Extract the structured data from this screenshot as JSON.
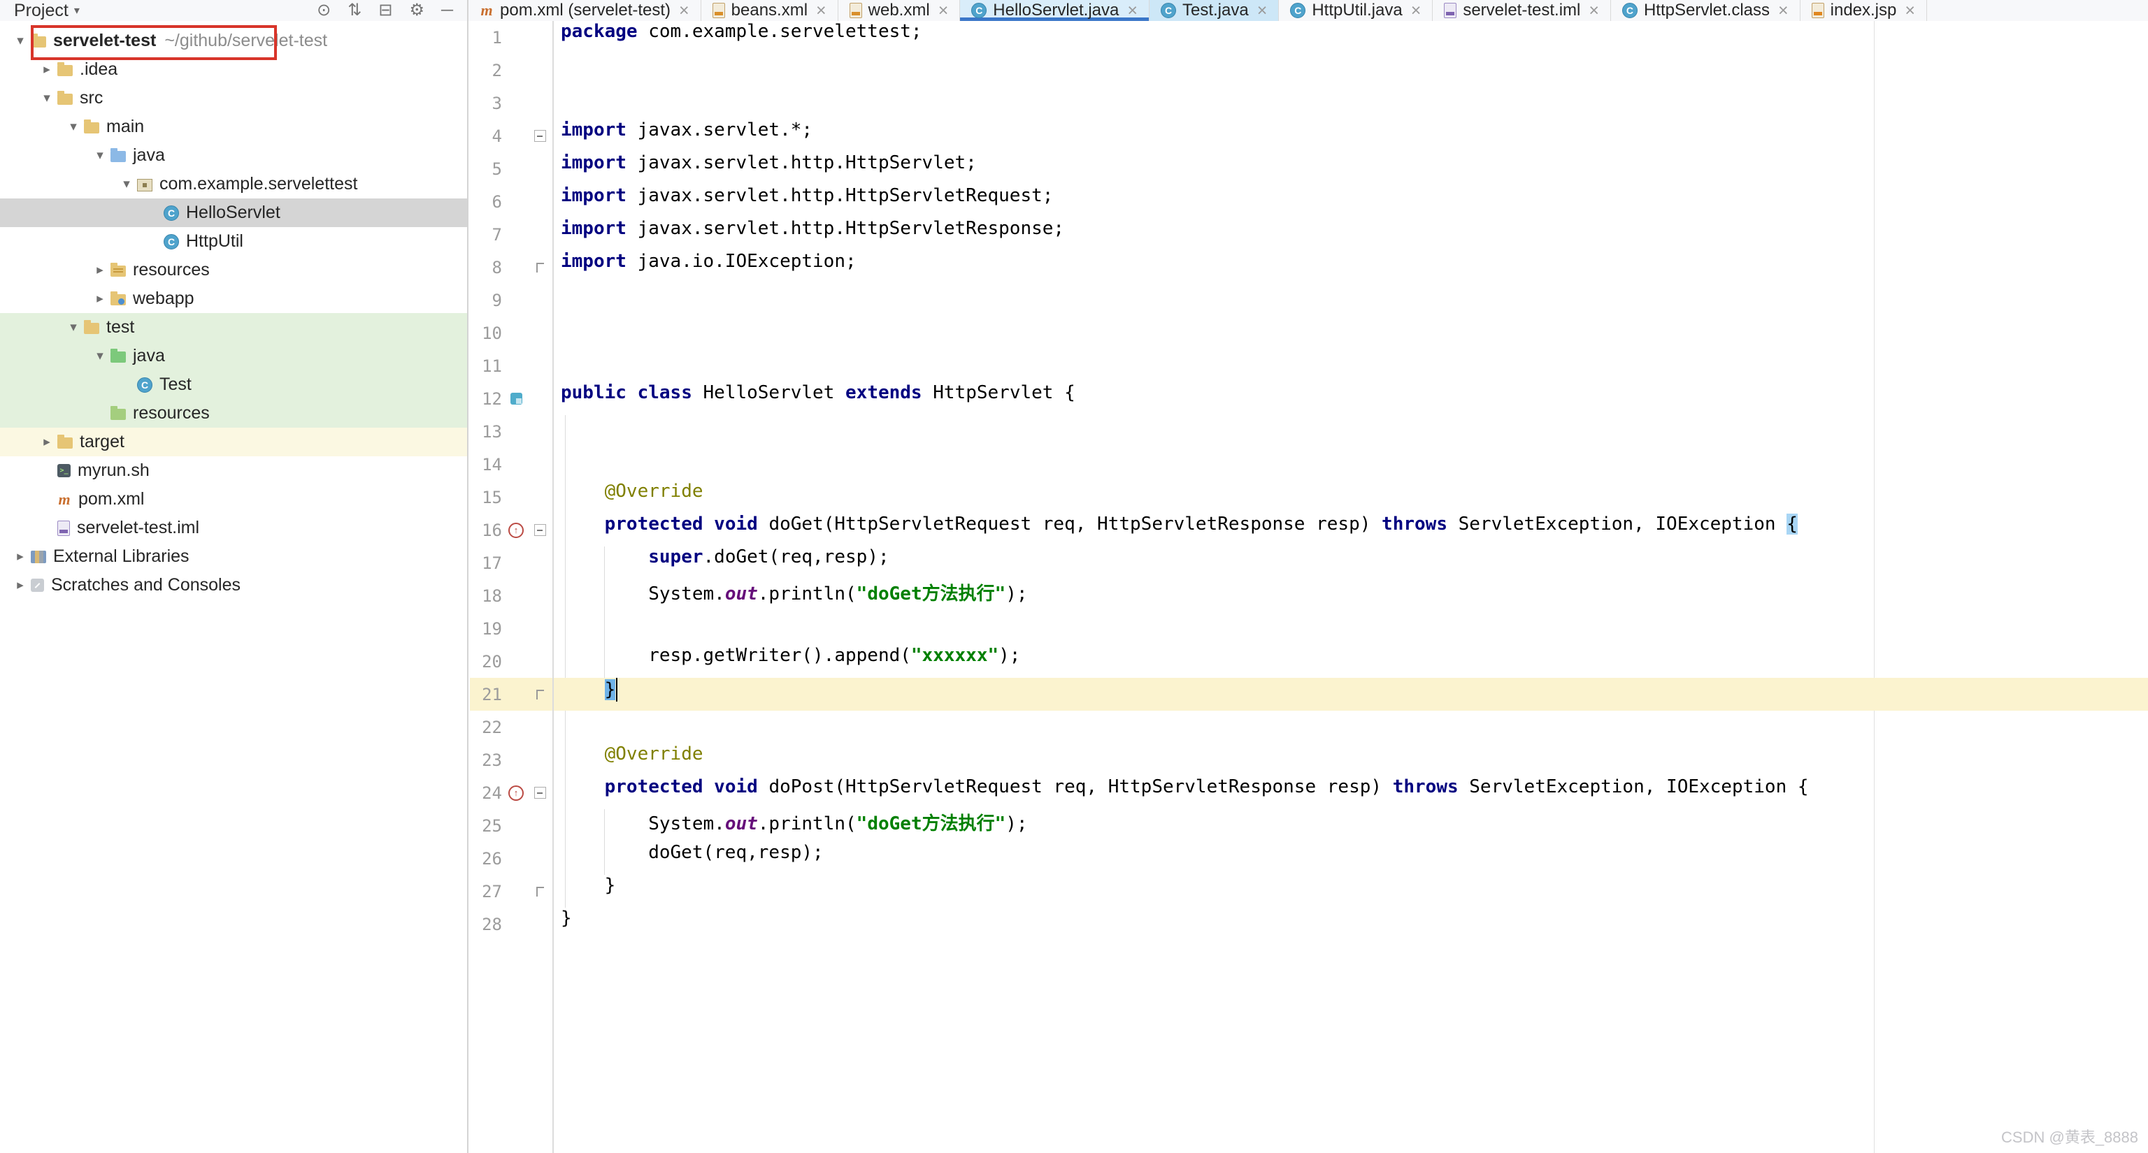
{
  "colors": {
    "keyword": "#000080",
    "string": "#008000",
    "annotation": "#808000",
    "static_field": "#660E7A",
    "active_tab_underline": "#3B77C9",
    "caret_row": "#FBF3CF",
    "selection_gray": "#D5D5D5",
    "vcs_added_green": "#E3F1DD",
    "excluded_yellow": "#FBF8E2",
    "red_annotation_box": "#D8352A"
  },
  "watermark": "CSDN @黄表_8888",
  "project_panel": {
    "title": "Project",
    "title_caret": "▾",
    "header_icons": [
      {
        "name": "locate-icon",
        "glyph": "⊙"
      },
      {
        "name": "sort-icon",
        "glyph": "⇅"
      },
      {
        "name": "collapse-all-icon",
        "glyph": "⊟"
      },
      {
        "name": "settings-icon",
        "glyph": "⚙"
      },
      {
        "name": "hide-panel-icon",
        "glyph": "─"
      }
    ],
    "tree": [
      {
        "label": "servelet-test",
        "suffix": "~/github/servelet-test",
        "level": 0,
        "icon": "project-folder",
        "chevron": "open",
        "bold": true,
        "red_box": true
      },
      {
        "label": ".idea",
        "level": 1,
        "icon": "folder",
        "chevron": "closed"
      },
      {
        "label": "src",
        "level": 1,
        "icon": "folder",
        "chevron": "open"
      },
      {
        "label": "main",
        "level": 2,
        "icon": "folder",
        "chevron": "open"
      },
      {
        "label": "java",
        "level": 3,
        "icon": "source-folder",
        "chevron": "open"
      },
      {
        "label": "com.example.servelettest",
        "level": 4,
        "icon": "package",
        "chevron": "open"
      },
      {
        "label": "HelloServlet",
        "level": 5,
        "icon": "class",
        "selected": true
      },
      {
        "label": "HttpUtil",
        "level": 5,
        "icon": "class"
      },
      {
        "label": "resources",
        "level": 3,
        "icon": "resources-folder",
        "chevron": "closed"
      },
      {
        "label": "webapp",
        "level": 3,
        "icon": "web-folder",
        "chevron": "closed"
      },
      {
        "label": "test",
        "level": 2,
        "icon": "folder",
        "chevron": "open",
        "highlight": "green"
      },
      {
        "label": "java",
        "level": 3,
        "icon": "test-folder",
        "chevron": "open",
        "highlight": "green"
      },
      {
        "label": "Test",
        "level": 4,
        "icon": "class",
        "highlight": "green"
      },
      {
        "label": "resources",
        "level": 3,
        "icon": "test-resources-folder",
        "highlight": "green"
      },
      {
        "label": "target",
        "level": 1,
        "icon": "folder",
        "chevron": "closed",
        "highlight": "yellow"
      },
      {
        "label": "myrun.sh",
        "level": 1,
        "icon": "shell-file"
      },
      {
        "label": "pom.xml",
        "level": 1,
        "icon": "maven-file"
      },
      {
        "label": "servelet-test.iml",
        "level": 1,
        "icon": "iml-file"
      },
      {
        "label": "External Libraries",
        "level": 0,
        "icon": "libraries",
        "chevron": "closed"
      },
      {
        "label": "Scratches and Consoles",
        "level": 0,
        "icon": "scratches",
        "chevron": "closed"
      }
    ]
  },
  "tabs": [
    {
      "label": "pom.xml (servelet-test)",
      "icon": "maven-file"
    },
    {
      "label": "beans.xml",
      "icon": "xml-file"
    },
    {
      "label": "web.xml",
      "icon": "xml-file"
    },
    {
      "label": "HelloServlet.java",
      "icon": "class",
      "active": true,
      "tinted": true
    },
    {
      "label": "Test.java",
      "icon": "class",
      "tinted": true
    },
    {
      "label": "HttpUtil.java",
      "icon": "class"
    },
    {
      "label": "servelet-test.iml",
      "icon": "iml-file"
    },
    {
      "label": "HttpServlet.class",
      "icon": "class"
    },
    {
      "label": "index.jsp",
      "icon": "jsp-file"
    }
  ],
  "editor": {
    "lines": [
      {
        "num": 1,
        "segs": [
          [
            "kw",
            "package"
          ],
          [
            "pl",
            " com.example.servelettest;"
          ]
        ]
      },
      {
        "num": 2,
        "segs": []
      },
      {
        "num": 3,
        "segs": []
      },
      {
        "num": 4,
        "fold": "start",
        "segs": [
          [
            "kw",
            "import"
          ],
          [
            "pl",
            " javax.servlet.*;"
          ]
        ]
      },
      {
        "num": 5,
        "segs": [
          [
            "kw",
            "import"
          ],
          [
            "pl",
            " javax.servlet.http.HttpServlet;"
          ]
        ]
      },
      {
        "num": 6,
        "segs": [
          [
            "kw",
            "import"
          ],
          [
            "pl",
            " javax.servlet.http.HttpServletRequest;"
          ]
        ]
      },
      {
        "num": 7,
        "segs": [
          [
            "kw",
            "import"
          ],
          [
            "pl",
            " javax.servlet.http.HttpServletResponse;"
          ]
        ]
      },
      {
        "num": 8,
        "fold": "end",
        "segs": [
          [
            "kw",
            "import"
          ],
          [
            "pl",
            " java.io.IOException;"
          ]
        ]
      },
      {
        "num": 9,
        "segs": []
      },
      {
        "num": 10,
        "segs": []
      },
      {
        "num": 11,
        "segs": []
      },
      {
        "num": 12,
        "gicon": "class-marker",
        "segs": [
          [
            "kw",
            "public"
          ],
          [
            "pl",
            " "
          ],
          [
            "kw",
            "class"
          ],
          [
            "pl",
            " HelloServlet "
          ],
          [
            "kw",
            "extends"
          ],
          [
            "pl",
            " HttpServlet {"
          ]
        ]
      },
      {
        "num": 13,
        "segs": []
      },
      {
        "num": 14,
        "segs": []
      },
      {
        "num": 15,
        "segs": [
          [
            "pl",
            "    "
          ],
          [
            "ann",
            "@Override"
          ]
        ]
      },
      {
        "num": 16,
        "gicon": "override",
        "fold": "start",
        "segs": [
          [
            "pl",
            "    "
          ],
          [
            "kw",
            "protected"
          ],
          [
            "pl",
            " "
          ],
          [
            "kw",
            "void"
          ],
          [
            "pl",
            " doGet(HttpServletRequest req, HttpServletResponse resp) "
          ],
          [
            "kw",
            "throws"
          ],
          [
            "pl",
            " ServletException, IOException "
          ],
          [
            "braceA",
            "{"
          ]
        ]
      },
      {
        "num": 17,
        "segs": [
          [
            "pl",
            "        "
          ],
          [
            "kw",
            "super"
          ],
          [
            "pl",
            ".doGet(req,resp);"
          ]
        ]
      },
      {
        "num": 18,
        "segs": [
          [
            "pl",
            "        System."
          ],
          [
            "fld",
            "out"
          ],
          [
            "pl",
            ".println("
          ],
          [
            "str",
            "\"doGet方法执行\""
          ],
          [
            "pl",
            ");"
          ]
        ]
      },
      {
        "num": 19,
        "segs": []
      },
      {
        "num": 20,
        "segs": [
          [
            "pl",
            "        resp.getWriter().append("
          ],
          [
            "str",
            "\"xxxxxx\""
          ],
          [
            "pl",
            ");"
          ]
        ]
      },
      {
        "num": 21,
        "current": true,
        "fold": "end",
        "segs": [
          [
            "pl",
            "    "
          ],
          [
            "braceB",
            "}"
          ]
        ]
      },
      {
        "num": 22,
        "segs": []
      },
      {
        "num": 23,
        "segs": [
          [
            "pl",
            "    "
          ],
          [
            "ann",
            "@Override"
          ]
        ]
      },
      {
        "num": 24,
        "gicon": "override",
        "fold": "start",
        "segs": [
          [
            "pl",
            "    "
          ],
          [
            "kw",
            "protected"
          ],
          [
            "pl",
            " "
          ],
          [
            "kw",
            "void"
          ],
          [
            "pl",
            " doPost(HttpServletRequest req, HttpServletResponse resp) "
          ],
          [
            "kw",
            "throws"
          ],
          [
            "pl",
            " ServletException, IOException {"
          ]
        ]
      },
      {
        "num": 25,
        "segs": [
          [
            "pl",
            "        System."
          ],
          [
            "fld",
            "out"
          ],
          [
            "pl",
            ".println("
          ],
          [
            "str",
            "\"doGet方法执行\""
          ],
          [
            "pl",
            ");"
          ]
        ]
      },
      {
        "num": 26,
        "segs": [
          [
            "pl",
            "        doGet(req,resp);"
          ]
        ]
      },
      {
        "num": 27,
        "fold": "end",
        "segs": [
          [
            "pl",
            "    }"
          ]
        ]
      },
      {
        "num": 28,
        "segs": [
          [
            "pl",
            "}"
          ]
        ]
      }
    ]
  }
}
